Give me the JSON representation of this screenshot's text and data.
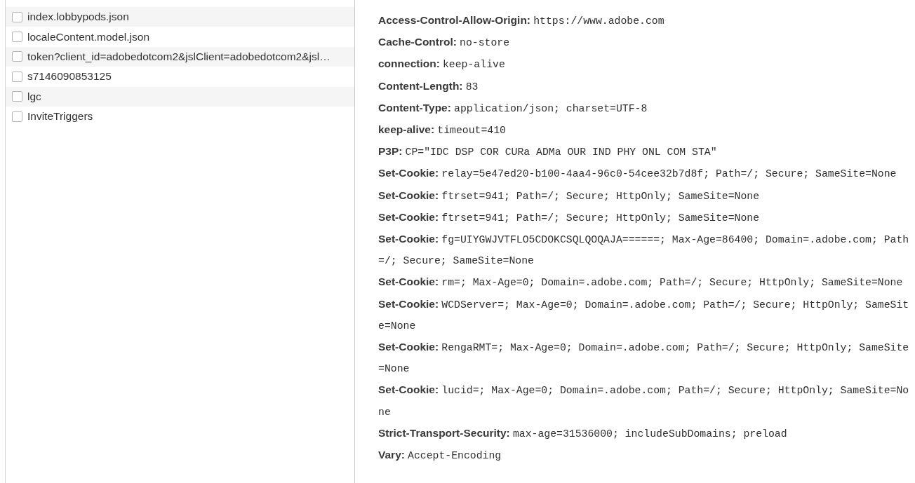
{
  "requests": [
    {
      "name": "index.lobbypods.json",
      "checked": false
    },
    {
      "name": "localeContent.model.json",
      "checked": false
    },
    {
      "name": "token?client_id=adobedotcom2&jslClient=adobedotcom2&jsl…",
      "checked": false
    },
    {
      "name": "s7146090853125",
      "checked": false
    },
    {
      "name": "lgc",
      "checked": false
    },
    {
      "name": "InviteTriggers",
      "checked": false
    }
  ],
  "response_headers": [
    {
      "key": "Access-Control-Allow-Origin:",
      "value": "https://www.adobe.com"
    },
    {
      "key": "Cache-Control:",
      "value": "no-store"
    },
    {
      "key": "connection:",
      "value": "keep-alive"
    },
    {
      "key": "Content-Length:",
      "value": "83"
    },
    {
      "key": "Content-Type:",
      "value": "application/json; charset=UTF-8"
    },
    {
      "key": "keep-alive:",
      "value": "timeout=410"
    },
    {
      "key": "P3P:",
      "value": "CP=\"IDC DSP COR CURa ADMa OUR IND PHY ONL COM STA\""
    },
    {
      "key": "Set-Cookie:",
      "value": "relay=5e47ed20-b100-4aa4-96c0-54cee32b7d8f; Path=/; Secure; SameSite=None"
    },
    {
      "key": "Set-Cookie:",
      "value": "ftrset=941; Path=/; Secure; HttpOnly; SameSite=None"
    },
    {
      "key": "Set-Cookie:",
      "value": "ftrset=941; Path=/; Secure; HttpOnly; SameSite=None"
    },
    {
      "key": "Set-Cookie:",
      "value": "fg=UIYGWJVTFLO5CDOKCSQLQOQAJA======; Max-Age=86400; Domain=.adobe.com; Path=/; Secure; SameSite=None"
    },
    {
      "key": "Set-Cookie:",
      "value": "rm=; Max-Age=0; Domain=.adobe.com; Path=/; Secure; HttpOnly; SameSite=None"
    },
    {
      "key": "Set-Cookie:",
      "value": "WCDServer=; Max-Age=0; Domain=.adobe.com; Path=/; Secure; HttpOnly; SameSite=None"
    },
    {
      "key": "Set-Cookie:",
      "value": "RengaRMT=; Max-Age=0; Domain=.adobe.com; Path=/; Secure; HttpOnly; SameSite=None"
    },
    {
      "key": "Set-Cookie:",
      "value": "lucid=; Max-Age=0; Domain=.adobe.com; Path=/; Secure; HttpOnly; SameSite=None"
    },
    {
      "key": "Strict-Transport-Security:",
      "value": "max-age=31536000; includeSubDomains; preload"
    },
    {
      "key": "Vary:",
      "value": "Accept-Encoding"
    }
  ]
}
